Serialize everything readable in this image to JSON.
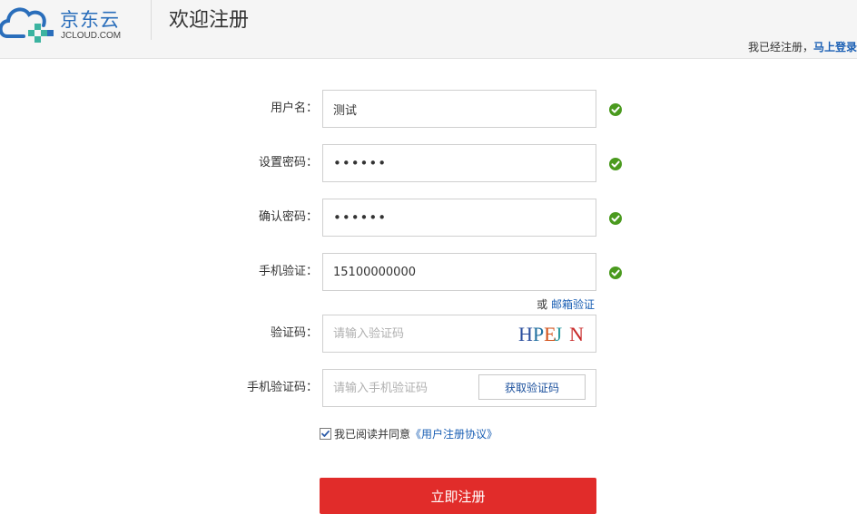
{
  "header": {
    "logo_cn": "京东云",
    "logo_en": "JCLOUD.COM",
    "title": "欢迎注册",
    "login_prompt": "我已经注册，",
    "login_link": "马上登录"
  },
  "form": {
    "username": {
      "label": "用户名：",
      "value": "测试",
      "valid": true
    },
    "password": {
      "label": "设置密码：",
      "value": "••••••",
      "valid": true
    },
    "confirm_password": {
      "label": "确认密码：",
      "value": "••••••",
      "valid": true
    },
    "phone": {
      "label": "手机验证：",
      "value": "15100000000",
      "valid": true
    },
    "alt_verify": {
      "prefix": "或 ",
      "link": "邮箱验证"
    },
    "captcha": {
      "label": "验证码：",
      "placeholder": "请输入验证码",
      "image_text": "HPEJ N"
    },
    "sms_code": {
      "label": "手机验证码：",
      "placeholder": "请输入手机验证码",
      "button": "获取验证码"
    },
    "agreement": {
      "checked": true,
      "text": "我已阅读并同意",
      "link": "《用户注册协议》"
    },
    "submit": "立即注册"
  },
  "colors": {
    "brand_blue": "#2a6ebb",
    "link_blue": "#1a5fb4",
    "valid_green": "#4a9a1e",
    "submit_red": "#e12c2a"
  },
  "icons": [
    "cloud-logo-icon",
    "check-circle-icon",
    "checkbox-checked-icon"
  ]
}
